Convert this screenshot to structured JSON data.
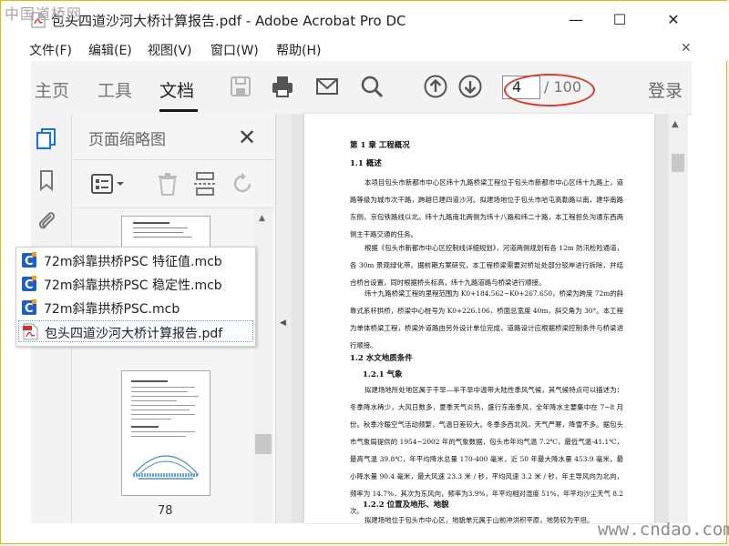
{
  "watermark_top": "中国道桥网",
  "watermark_bottom": "www.cndao.com",
  "window": {
    "title": "包头四道沙河大桥计算报告.pdf - Adobe Acrobat Pro DC",
    "min_glyph": "—",
    "max_glyph": "☐",
    "close_glyph": "✕"
  },
  "menu": {
    "items": [
      "文件(F)",
      "编辑(E)",
      "视图(V)",
      "窗口(W)",
      "帮助(H)"
    ],
    "close_doc_glyph": "✕"
  },
  "toolbar": {
    "tabs": [
      "主页",
      "工具",
      "文档"
    ],
    "active_tab": "文档",
    "current_page": "4",
    "page_total": "/ 100",
    "login": "登录"
  },
  "thumb_panel": {
    "title": "页面缩略图",
    "close_glyph": "✕",
    "page_label": "78"
  },
  "file_list": [
    {
      "name": "72m斜靠拱桥PSC 特征值.mcb",
      "type": "mcb",
      "selected": false
    },
    {
      "name": "72m斜靠拱桥PSC 稳定性.mcb",
      "type": "mcb",
      "selected": false
    },
    {
      "name": "72m斜靠拱桥PSC.mcb",
      "type": "mcb",
      "selected": false
    },
    {
      "name": "包头四道沙河大桥计算报告.pdf",
      "type": "pdf",
      "selected": true
    }
  ],
  "document": {
    "chapter": "第 1 章  工程概况",
    "s1_1": "1.1 概述",
    "p1": "本项目包头市新都市中心区纬十九路桥梁工程位于包头市新都市中心区纬十九路上，道路等级为城市次干路，跨越已建四道沙河。拟建场地位于包头市哈屯高勒路以南，建华南路东侧，京包铁路线以北。纬十九路南北两侧为纬十八路和纬二十路，本工程担负沟通东西两侧主干路交通的任务。",
    "p2": "根据《包头市新都市中心区控制线详细规划》，河道两侧规划有各 12m 防汛检险通道，各 30m 景观绿化带。据前期方案研究，本工程桥梁需要对桥址处部分驳岸进行拆除，并结合桥台设置，同时根据桥头标高，纬十九路道路与桥梁进行顺接。",
    "p3": "纬十九路桥梁工程的里程范围为 K0+184.562~K0+267.650，桥梁为跨度 72m的斜靠式系杆拱桥，桥梁中心桩号为 K0+226.106，桥面总宽度 40m，斜交角为 30°。本工程为单体桥梁工程，桥梁外道路由另外设计单位完成，道路设计应根据桥梁控制条件与桥梁进行顺接。",
    "s1_2": "1.2 水文地质条件",
    "s1_2_1": "1.2.1 气象",
    "p4": "拟建场地所处地区属于干旱—半干旱中温带大陆性季风气候，其气候特点可以描述为：冬季降水稀少，大风日数多，夏季天气炎热，盛行东南季风，全年降水主要集中在 7~8 月份。秋季冷暖空气活动频繁，气温日差较大。冬季多西北风，天气严寒，降雪不多。据包头市气象局提供的 1954~2002 年的气象数据，包头市年均气温 7.2℃，最低气温-41.1℃，最高气温 39.8℃，年平均降水总量 170-400 毫米，近 50 年最大降水量 453.9 毫米，最小降水量 90.4 毫米，最大风速 23.3 米 / 秒，平均风速 3.2 米 / 秒，年主导风向为北向，频率为 14.7%，其次为东风向，频率为3.9%，年平均相对湿度 51%，年平均沙尘天气 8.2 次。",
    "s1_2_2": "1.2.2 位置及地形、地貌",
    "p5": "拟建场地位于包头市中心区，地貌单元属于山前冲洪积平原，地势较为平坦。"
  },
  "colors": {
    "accent_red": "#d93a2e",
    "pdf_red": "#d32f2f",
    "mcb_blue": "#1e5fbf",
    "mcb_orange": "#f0a020"
  }
}
